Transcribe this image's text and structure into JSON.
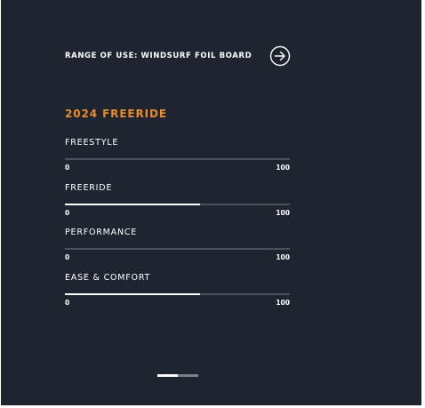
{
  "header": {
    "title": "RANGE OF USE: WINDSURF FOIL BOARD",
    "arrow_icon": "arrow-right-circle-icon"
  },
  "section": {
    "title": "2024 FREERIDE",
    "title_color": "#e98b2a"
  },
  "metrics": [
    {
      "label": "FREESTYLE",
      "min": "0",
      "max": "100",
      "value": 0
    },
    {
      "label": "FREERIDE",
      "min": "0",
      "max": "100",
      "value": 60
    },
    {
      "label": "PERFORMANCE",
      "min": "0",
      "max": "100",
      "value": 0
    },
    {
      "label": "EASE & COMFORT",
      "min": "0",
      "max": "100",
      "value": 60
    }
  ],
  "pager": {
    "pages": 2,
    "active_index": 0,
    "active_color": "#ffffff",
    "inactive_color": "#7a808a"
  },
  "colors": {
    "background": "#1f2530",
    "track": "#4b525d",
    "fill": "#ffffff"
  }
}
